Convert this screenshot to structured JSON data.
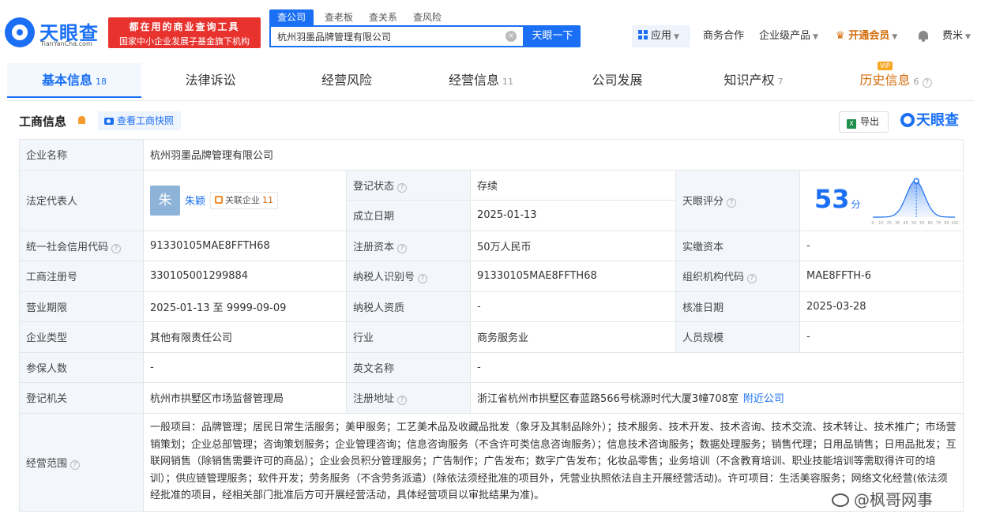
{
  "header": {
    "logo_text": "天眼查",
    "logo_sub": "TianYanCha.com",
    "promo_line1": "都在用的商业查询工具",
    "promo_line2": "国家中小企业发展子基金旗下机构",
    "search_tabs": [
      "查公司",
      "查老板",
      "查关系",
      "查风险"
    ],
    "search_value": "杭州羽墨品牌管理有限公司",
    "search_button": "天眼一下",
    "apps_label": "应用",
    "nav": [
      "商务合作",
      "企业级产品",
      "开通会员"
    ],
    "user": "费米"
  },
  "tabs": [
    {
      "label": "基本信息",
      "count": "18"
    },
    {
      "label": "法律诉讼",
      "count": ""
    },
    {
      "label": "经营风险",
      "count": ""
    },
    {
      "label": "经营信息",
      "count": "11"
    },
    {
      "label": "公司发展",
      "count": ""
    },
    {
      "label": "知识产权",
      "count": "7"
    },
    {
      "label": "历史信息",
      "count": "6",
      "badge": "VIP"
    }
  ],
  "section": {
    "title": "工商信息",
    "snapshot_button": "查看工商快照",
    "export_button": "导出",
    "brand": "天眼查"
  },
  "info": {
    "company_name_label": "企业名称",
    "company_name": "杭州羽墨品牌管理有限公司",
    "legal_rep_label": "法定代表人",
    "legal_rep_avatar": "朱",
    "legal_rep_name": "朱颖",
    "assoc_label": "关联企业",
    "assoc_count": "11",
    "reg_status_label": "登记状态",
    "reg_status": "存续",
    "found_date_label": "成立日期",
    "found_date": "2025-01-13",
    "score_label": "天眼评分",
    "score": "53",
    "score_unit": "分",
    "credit_code_label": "统一社会信用代码",
    "credit_code": "91330105MAE8FFTH68",
    "reg_capital_label": "注册资本",
    "reg_capital": "50万人民币",
    "paid_capital_label": "实缴资本",
    "paid_capital": "-",
    "reg_no_label": "工商注册号",
    "reg_no": "330105001299884",
    "taxpayer_id_label": "纳税人识别号",
    "taxpayer_id": "91330105MAE8FFTH68",
    "org_code_label": "组织机构代码",
    "org_code": "MAE8FFTH-6",
    "term_label": "营业期限",
    "term": "2025-01-13 至 9999-09-09",
    "taxpayer_qual_label": "纳税人资质",
    "taxpayer_qual": "-",
    "approve_date_label": "核准日期",
    "approve_date": "2025-03-28",
    "type_label": "企业类型",
    "type": "其他有限责任公司",
    "industry_label": "行业",
    "industry": "商务服务业",
    "staff_label": "人员规模",
    "staff": "-",
    "insured_label": "参保人数",
    "insured": "-",
    "english_name_label": "英文名称",
    "english_name": "-",
    "authority_label": "登记机关",
    "authority": "杭州市拱墅区市场监督管理局",
    "address_label": "注册地址",
    "address": "浙江省杭州市拱墅区春蓝路566号桃源时代大厦3幢708室",
    "nearby_link": "附近公司",
    "scope_label": "经营范围",
    "scope": "一般项目：品牌管理；居民日常生活服务；美甲服务；工艺美术品及收藏品批发（象牙及其制品除外）；技术服务、技术开发、技术咨询、技术交流、技术转让、技术推广；市场营销策划；企业总部管理；咨询策划服务；企业管理咨询；信息咨询服务（不含许可类信息咨询服务）；信息技术咨询服务；数据处理服务；销售代理；日用品销售；日用品批发；互联网销售（除销售需要许可的商品）；企业会员积分管理服务；广告制作；广告发布；数字广告发布；化妆品零售；业务培训（不含教育培训、职业技能培训等需取得许可的培训）；供应链管理服务；软件开发；劳务服务（不含劳务派遣）(除依法须经批准的项目外，凭营业执照依法自主开展经营活动)。许可项目：生活美容服务；网络文化经营(依法须经批准的项目，经相关部门批准后方可开展经营活动，具体经营项目以审批结果为准)。"
  },
  "score_chart": {
    "x_ticks": [
      "0",
      "15",
      "25",
      "35",
      "45",
      "50",
      "55",
      "65",
      "75",
      "85",
      "100"
    ],
    "marker_value": 53
  },
  "watermark": "@枫哥网事",
  "colors": {
    "brand": "#1a6ff4",
    "promo": "#e8322e",
    "status_green": "#28a745",
    "vip": "#d46b08"
  }
}
